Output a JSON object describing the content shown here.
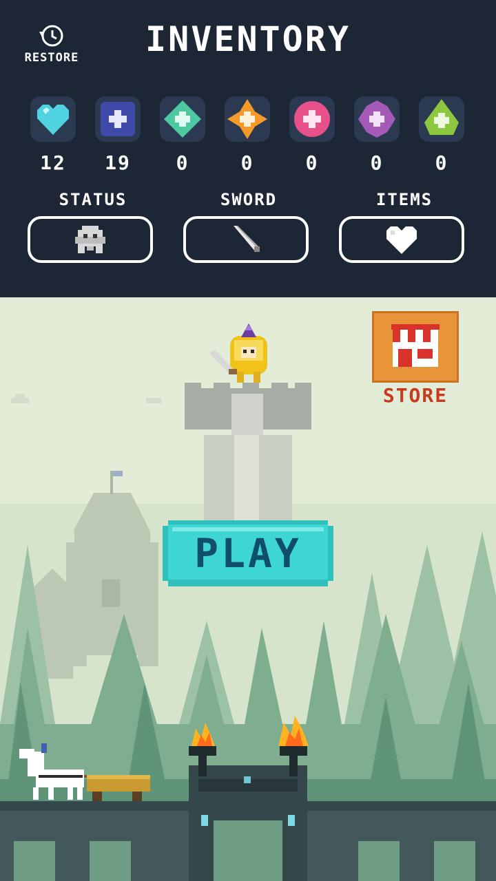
{
  "header": {
    "title": "INVENTORY",
    "restore_label": "RESTORE"
  },
  "gems": [
    {
      "icon": "cyan-heart-gem-icon",
      "color": "#4fd3e0",
      "count": "12"
    },
    {
      "icon": "blue-gem-icon",
      "color": "#3f4aa8",
      "count": "19"
    },
    {
      "icon": "green-gem-icon",
      "color": "#4cc9a0",
      "count": "0"
    },
    {
      "icon": "orange-gem-icon",
      "color": "#f59a2a",
      "count": "0"
    },
    {
      "icon": "pink-gem-icon",
      "color": "#e8508a",
      "count": "0"
    },
    {
      "icon": "purple-gem-icon",
      "color": "#a55ab8",
      "count": "0"
    },
    {
      "icon": "lime-gem-icon",
      "color": "#8dc63f",
      "count": "0"
    }
  ],
  "categories": [
    {
      "label": "STATUS",
      "icon": "ghost-icon"
    },
    {
      "label": "SWORD",
      "icon": "sword-icon"
    },
    {
      "label": "ITEMS",
      "icon": "heart-icon"
    }
  ],
  "scene": {
    "store_label": "STORE",
    "play_label": "PLAY"
  },
  "colors": {
    "panel_bg": "#1c2634",
    "sky": "#e3ecd7",
    "play_button": "#3ed6d2",
    "play_text": "#0f4f6b",
    "store_bg": "#e8953a",
    "store_text": "#c63a1e"
  }
}
